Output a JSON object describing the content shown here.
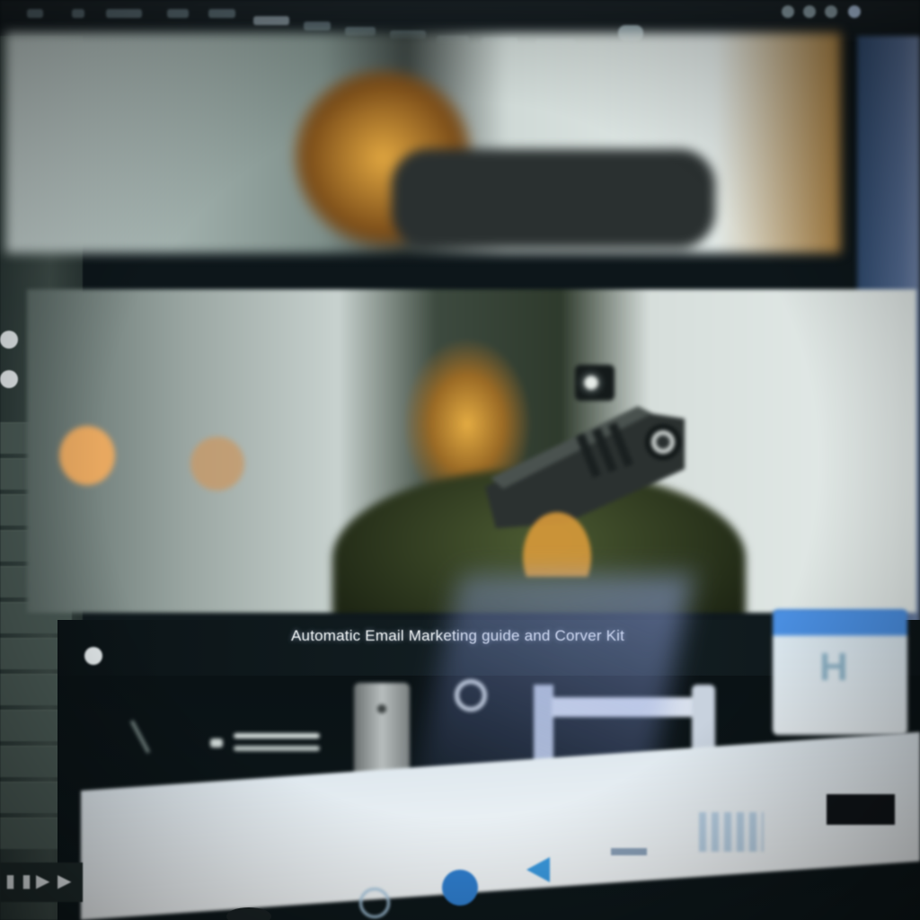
{
  "caption": {
    "text": "Automatic Email Marketing guide and Corver Kit"
  },
  "thumbnail_card": {
    "glyph": "H"
  },
  "colors": {
    "accent_blue": "#2f7fd0",
    "panel_green": "#3e4c48",
    "skin_orange": "#d7a53a"
  },
  "icons": {
    "caption_dot": "record-dot-icon",
    "play": "play-icon",
    "record": "record-icon",
    "rewind": "rewind-icon",
    "settings": "settings-icon"
  }
}
